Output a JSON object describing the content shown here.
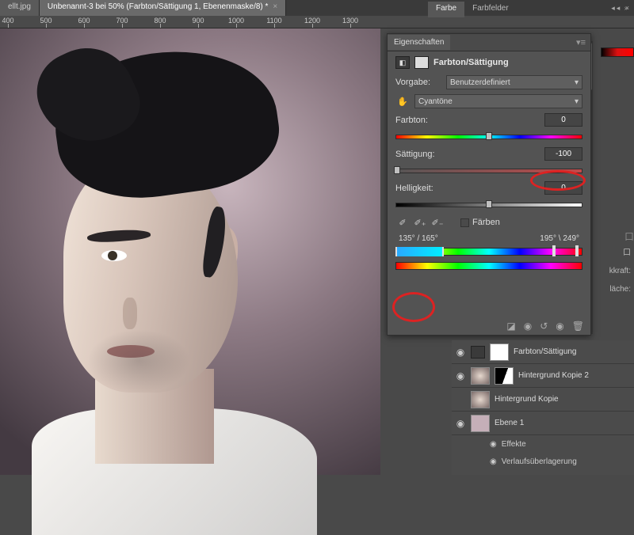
{
  "tabs": {
    "doc1": "ellt.jpg",
    "doc2": "Unbenannt-3 bei 50% (Farbton/Sättigung 1, Ebenenmaske/8) *"
  },
  "ruler_marks": [
    "400",
    "500",
    "600",
    "700",
    "800",
    "900",
    "1000",
    "1100",
    "1200",
    "1300"
  ],
  "right_tabs": {
    "farbe": "Farbe",
    "farbfelder": "Farbfelder"
  },
  "props": {
    "panel_title": "Eigenschaften",
    "kind": "Farbton/Sättigung",
    "preset_label": "Vorgabe:",
    "preset_value": "Benutzerdefiniert",
    "channel_value": "Cyantöne",
    "hue_label": "Farbton:",
    "hue_value": "0",
    "sat_label": "Sättigung:",
    "sat_value": "-100",
    "light_label": "Helligkeit:",
    "light_value": "0",
    "colorize_label": "Färben",
    "deg_left": "135° / 165°",
    "deg_right": "195° \\ 249°"
  },
  "dock": {
    "kkraft": "kkraft:",
    "flaeche": "läche:"
  },
  "layers": {
    "l1": "Farbton/Sättigung",
    "l2": "Hintergrund Kopie 2",
    "l3": "Hintergrund Kopie",
    "l4": "Ebene 1",
    "fx": "Effekte",
    "fx1": "Verlaufsüberlagerung"
  }
}
